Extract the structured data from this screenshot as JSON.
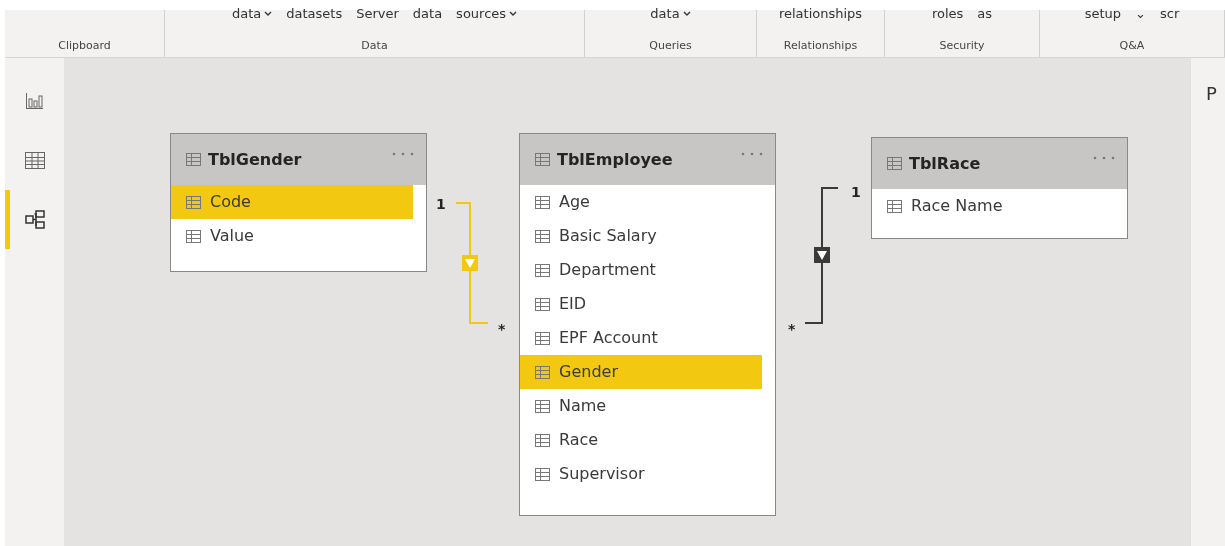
{
  "ribbon": {
    "groups": [
      {
        "label": "Clipboard"
      },
      {
        "label": "Data",
        "items": [
          {
            "text": "data",
            "dropdown": true
          },
          {
            "text": "datasets",
            "dropdown": false
          },
          {
            "text": "Server",
            "dropdown": false
          },
          {
            "text": "data",
            "dropdown": false
          },
          {
            "text": "sources",
            "dropdown": true
          }
        ]
      },
      {
        "label": "Queries",
        "items": [
          {
            "text": "data",
            "dropdown": true
          }
        ]
      },
      {
        "label": "Relationships",
        "items": [
          {
            "text": "relationships",
            "dropdown": false
          }
        ]
      },
      {
        "label": "Security",
        "items": [
          {
            "text": "roles",
            "dropdown": false
          },
          {
            "text": "as",
            "dropdown": false
          }
        ]
      },
      {
        "label": "Q&A",
        "items": [
          {
            "text": "setup",
            "dropdown": false
          },
          {
            "text": "⌄",
            "dropdown": false
          },
          {
            "text": "scr",
            "dropdown": false
          }
        ]
      }
    ]
  },
  "sidebar": {
    "items": [
      {
        "kind": "report",
        "selected": false
      },
      {
        "kind": "data",
        "selected": false
      },
      {
        "kind": "model",
        "selected": true
      }
    ]
  },
  "tables": [
    {
      "name": "TblGender",
      "fields": [
        {
          "name": "Code",
          "selected": true
        },
        {
          "name": "Value",
          "selected": false
        }
      ]
    },
    {
      "name": "TblEmployee",
      "fields": [
        {
          "name": "Age",
          "selected": false
        },
        {
          "name": "Basic Salary",
          "selected": false
        },
        {
          "name": "Department",
          "selected": false
        },
        {
          "name": "EID",
          "selected": false
        },
        {
          "name": "EPF Account",
          "selected": false
        },
        {
          "name": "Gender",
          "selected": true
        },
        {
          "name": "Name",
          "selected": false
        },
        {
          "name": "Race",
          "selected": false
        },
        {
          "name": "Supervisor",
          "selected": false
        }
      ]
    },
    {
      "name": "TblRace",
      "fields": [
        {
          "name": "Race Name",
          "selected": false
        }
      ]
    }
  ],
  "relationships": [
    {
      "one_label": "1",
      "many_label": "*",
      "selected": true
    },
    {
      "one_label": "1",
      "many_label": "*",
      "selected": false
    }
  ],
  "right_panel": {
    "title": "P"
  }
}
